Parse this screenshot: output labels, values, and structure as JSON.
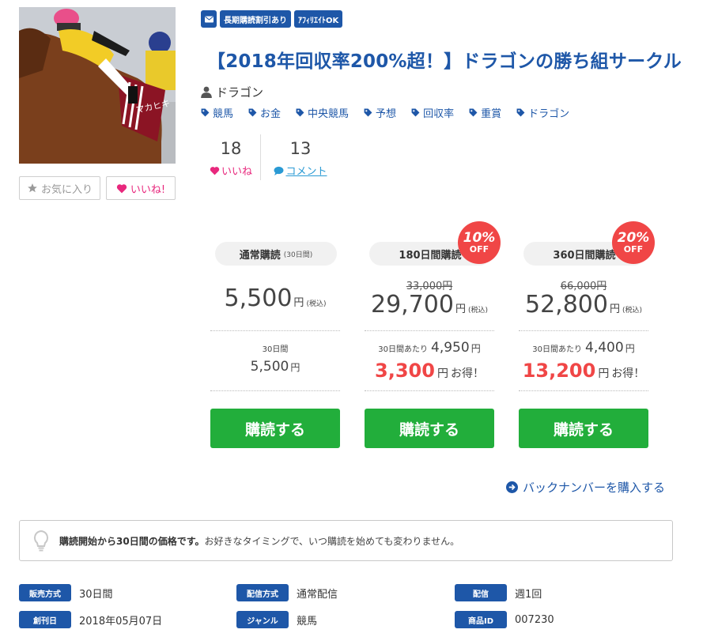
{
  "badges": {
    "mail_icon": "envelope-icon",
    "long_term": "長期購読割引あり",
    "affiliate": "ｱﾌｨﾘｴｲﾄOK"
  },
  "title": "【2018年回収率200%超！】ドラゴンの勝ち組サークル",
  "author": "ドラゴン",
  "tags": [
    "競馬",
    "お金",
    "中央競馬",
    "予想",
    "回収率",
    "重賞",
    "ドラゴン"
  ],
  "stats": {
    "likes_count": "18",
    "likes_label": "いいね",
    "comments_count": "13",
    "comments_label": "コメント"
  },
  "buttons": {
    "favorite": "お気に入り",
    "like": "いいね!"
  },
  "thumbnail_text": "マカヒキ",
  "plans": [
    {
      "name": "通常購読",
      "duration_note": "(30日間)",
      "price": "5,500",
      "yen": "円",
      "tax": "(税込)",
      "period_label": "30日間",
      "period_price": "5,500",
      "buy": "購読する"
    },
    {
      "name": "180日間購読",
      "original_price": "33,000円",
      "price": "29,700",
      "yen": "円",
      "tax": "(税込)",
      "per_label": "30日間あたり",
      "per_price": "4,950",
      "savings": "3,300",
      "savings_suffix": "お得！",
      "discount_pct": "10%",
      "discount_off": "OFF",
      "buy": "購読する"
    },
    {
      "name": "360日間購読",
      "original_price": "66,000円",
      "price": "52,800",
      "yen": "円",
      "tax": "(税込)",
      "per_label": "30日間あたり",
      "per_price": "4,400",
      "savings": "13,200",
      "savings_suffix": "お得！",
      "discount_pct": "20%",
      "discount_off": "OFF",
      "buy": "購読する"
    }
  ],
  "back_number": "バックナンバーを購入する",
  "notice": {
    "bold": "購読開始から30日間の価格です。",
    "text": "お好きなタイミングで、いつ購読を始めても変わりません。"
  },
  "info": [
    {
      "label": "販売方式",
      "value": "30日間"
    },
    {
      "label": "配信方式",
      "value": "通常配信"
    },
    {
      "label": "配信",
      "value": "週1回"
    },
    {
      "label": "創刊日",
      "value": "2018年05月07日"
    },
    {
      "label": "ジャンル",
      "value": "競馬"
    },
    {
      "label": "商品ID",
      "value": "007230"
    }
  ],
  "colors": {
    "brand_blue": "#1e57a8",
    "buy_green": "#22ae3b",
    "discount_red": "#f04646",
    "like_pink": "#e8287d",
    "comment_blue": "#2a9ad4"
  }
}
